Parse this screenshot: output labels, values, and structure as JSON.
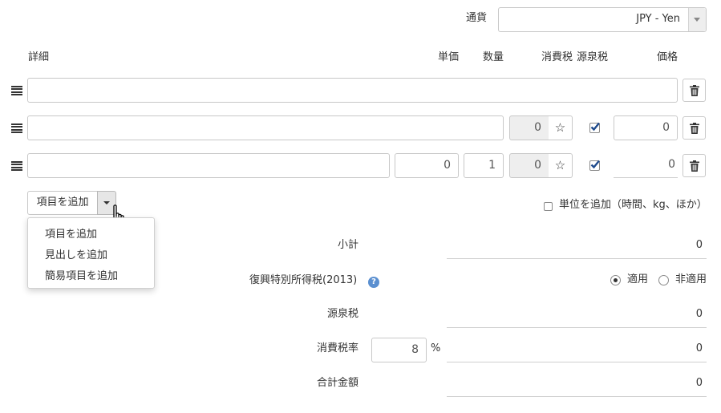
{
  "currency": {
    "label": "通貨",
    "value": "JPY - Yen"
  },
  "columns": {
    "detail": "詳細",
    "unit_price": "単価",
    "quantity": "数量",
    "consumption_tax": "消費税",
    "withholding_tax": "源泉税",
    "price": "価格"
  },
  "rows": [
    {
      "detail": ""
    },
    {
      "detail": "",
      "tax": "0",
      "tax_icon": "star-icon",
      "withholding": true,
      "price": "0"
    },
    {
      "detail": "",
      "unit_price": "0",
      "quantity": "1",
      "tax": "0",
      "tax_icon": "star-icon",
      "withholding": true,
      "price": "0"
    }
  ],
  "add_item": {
    "button_label": "項目を追加",
    "menu": [
      "項目を追加",
      "見出しを追加",
      "簡易項目を追加"
    ]
  },
  "unit_option": {
    "label": "単位を追加（時間、kg、ほか）",
    "checked": false
  },
  "summary": {
    "subtotal": {
      "label": "小計",
      "value": "0"
    },
    "reconstruction_tax": {
      "label": "復興特別所得税(2013)",
      "options": [
        "適用",
        "非適用"
      ],
      "selected": "適用"
    },
    "withholding": {
      "label": "源泉税",
      "value": "0"
    },
    "tax_rate": {
      "label": "消費税率",
      "value": "8",
      "unit": "%",
      "tax_value": "0"
    },
    "total": {
      "label": "合計金額",
      "value": "0"
    }
  },
  "colors": {
    "help_icon": "#5a8fd0",
    "check": "#1e4a8c"
  }
}
